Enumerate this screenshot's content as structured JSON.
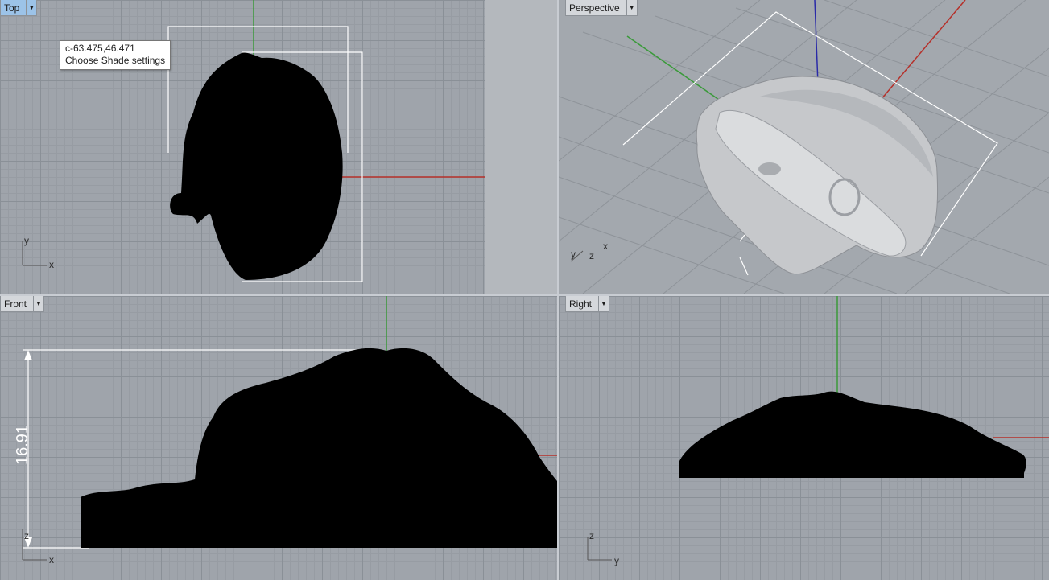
{
  "viewports": {
    "top": {
      "label": "Top",
      "active": true
    },
    "perspective": {
      "label": "Perspective",
      "active": false
    },
    "front": {
      "label": "Front",
      "active": false
    },
    "right": {
      "label": "Right",
      "active": false
    }
  },
  "tab_arrow_glyph": "▼",
  "tooltip": {
    "coords": "c-63.475,46.471",
    "text": "Choose Shade settings"
  },
  "dimensions": {
    "front_height": "16.91"
  },
  "axes": {
    "x": "x",
    "y": "y",
    "z": "z"
  },
  "colors": {
    "grid_bg": "#9fa4ab",
    "active_tab": "#9cc3e8",
    "axis_x": "#b5302a",
    "axis_y": "#3a9a3a",
    "axis_z": "#2a2aa8",
    "model_silhouette": "#000000",
    "model_shaded": "#c6c8cb"
  }
}
